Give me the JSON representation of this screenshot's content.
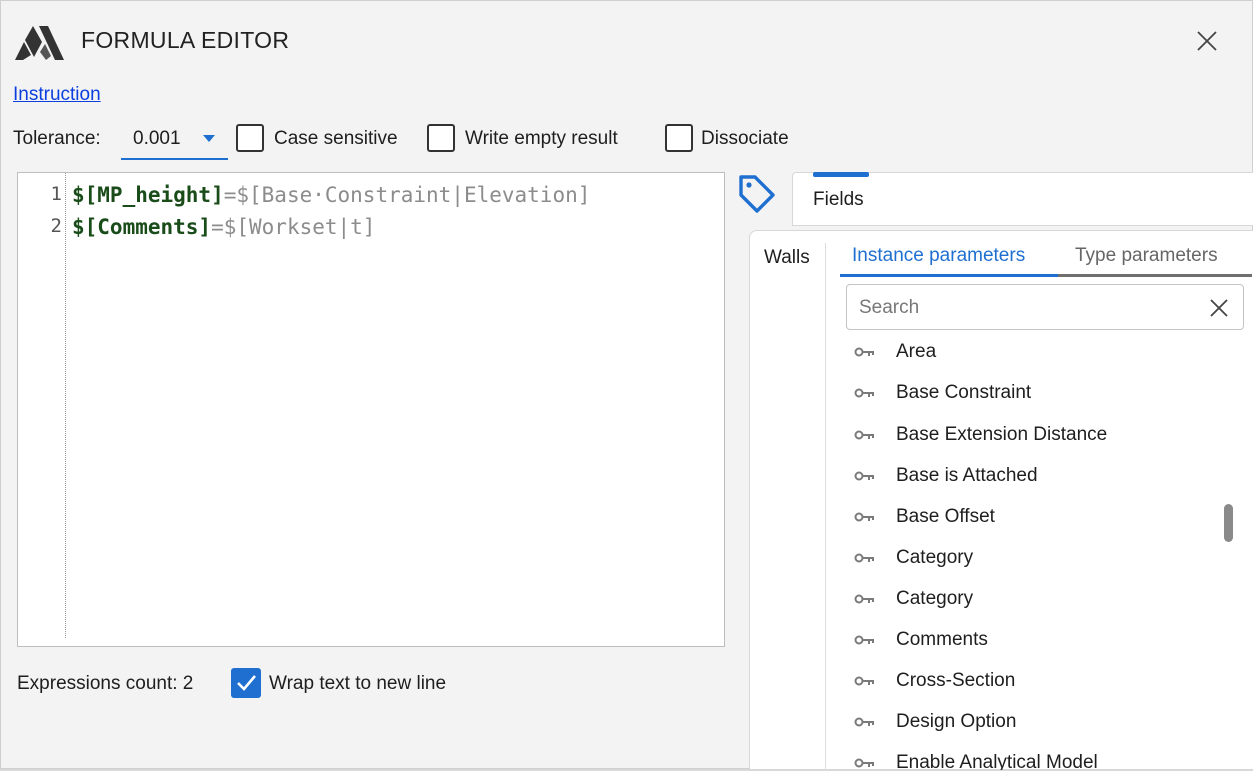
{
  "window": {
    "title": "FORMULA EDITOR"
  },
  "instruction_link": "Instruction",
  "options": {
    "tolerance_label": "Tolerance:",
    "tolerance_value": "0.001",
    "checkboxes": [
      {
        "label": "Case sensitive",
        "checked": false
      },
      {
        "label": "Write empty result",
        "checked": false
      },
      {
        "label": "Dissociate",
        "checked": false
      }
    ]
  },
  "editor": {
    "line_numbers": [
      "1",
      "2"
    ],
    "lines": [
      {
        "target": "$[MP_height]",
        "op": "=",
        "expr": "$[Base·Constraint|Elevation]"
      },
      {
        "target": "$[Comments]",
        "op": "=",
        "expr": "$[Workset|t]"
      }
    ]
  },
  "footer": {
    "expressions_count": "Expressions count: 2",
    "wrap_label": "Wrap text to new line",
    "wrap_checked": true
  },
  "fields_panel": {
    "title": "Fields"
  },
  "walls_panel": {
    "category_tab": "Walls",
    "tabs": [
      {
        "label": "Instance parameters",
        "active": true
      },
      {
        "label": "Type parameters",
        "active": false
      }
    ],
    "search_placeholder": "Search",
    "items": [
      "Area",
      "Base Constraint",
      "Base Extension Distance",
      "Base is Attached",
      "Base Offset",
      "Category",
      "Category",
      "Comments",
      "Cross-Section",
      "Design Option",
      "Enable Analytical Model"
    ]
  },
  "colors": {
    "accent": "#1f6fd1",
    "link": "#0b3fe0"
  }
}
